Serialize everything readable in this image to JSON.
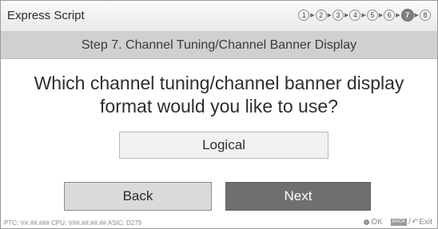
{
  "header": {
    "title": "Express Script",
    "steps": [
      "1",
      "2",
      "3",
      "4",
      "5",
      "6",
      "7",
      "8"
    ],
    "current_step": "7"
  },
  "step_bar": {
    "title": "Step 7. Channel Tuning/Channel Banner Display"
  },
  "main": {
    "question": "Which channel tuning/channel banner display format would you like to use?",
    "selected_option": "Logical"
  },
  "buttons": {
    "back_label": "Back",
    "next_label": "Next"
  },
  "footer": {
    "version_info": "PTC: V#.##.### CPU: V##.##.##.## ASIC: D279",
    "ok_label": "OK",
    "back_key_label": "BACK",
    "exit_label": "Exit"
  },
  "colors": {
    "step_bar_bg": "#d0d0d0",
    "next_button_bg": "#6f6f6f",
    "back_button_bg": "#dadada"
  }
}
